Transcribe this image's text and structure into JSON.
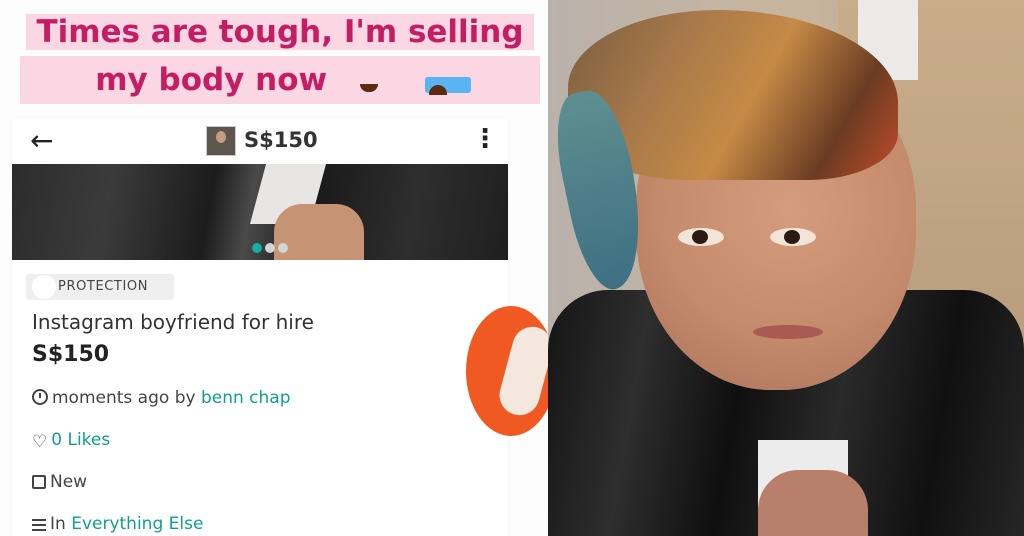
{
  "caption": {
    "line1": "Times are tough, I'm selling",
    "line2": "my body now",
    "emoji1": "face-with-tears-of-joy-icon",
    "emoji2": "loudly-crying-face-icon"
  },
  "listing": {
    "header": {
      "back_icon": "arrow-left-icon",
      "price": "S$150",
      "more_icon": "vertical-dots-icon"
    },
    "carousel": {
      "total": 3,
      "active_index": 1
    },
    "badge": "PROTECTION",
    "title": "Instagram boyfriend for hire",
    "price": "S$150",
    "posted": {
      "text": "moments ago by ",
      "seller": "benn     chap"
    },
    "likes": {
      "count_text": "0 Likes"
    },
    "condition": "New",
    "category": {
      "prefix": "In ",
      "name": "Everything Else"
    }
  },
  "colors": {
    "caption_text": "#c41d63",
    "caption_bg": "#fbd6e3",
    "accent": "#10a08f",
    "logo_orange": "#f05a22"
  }
}
